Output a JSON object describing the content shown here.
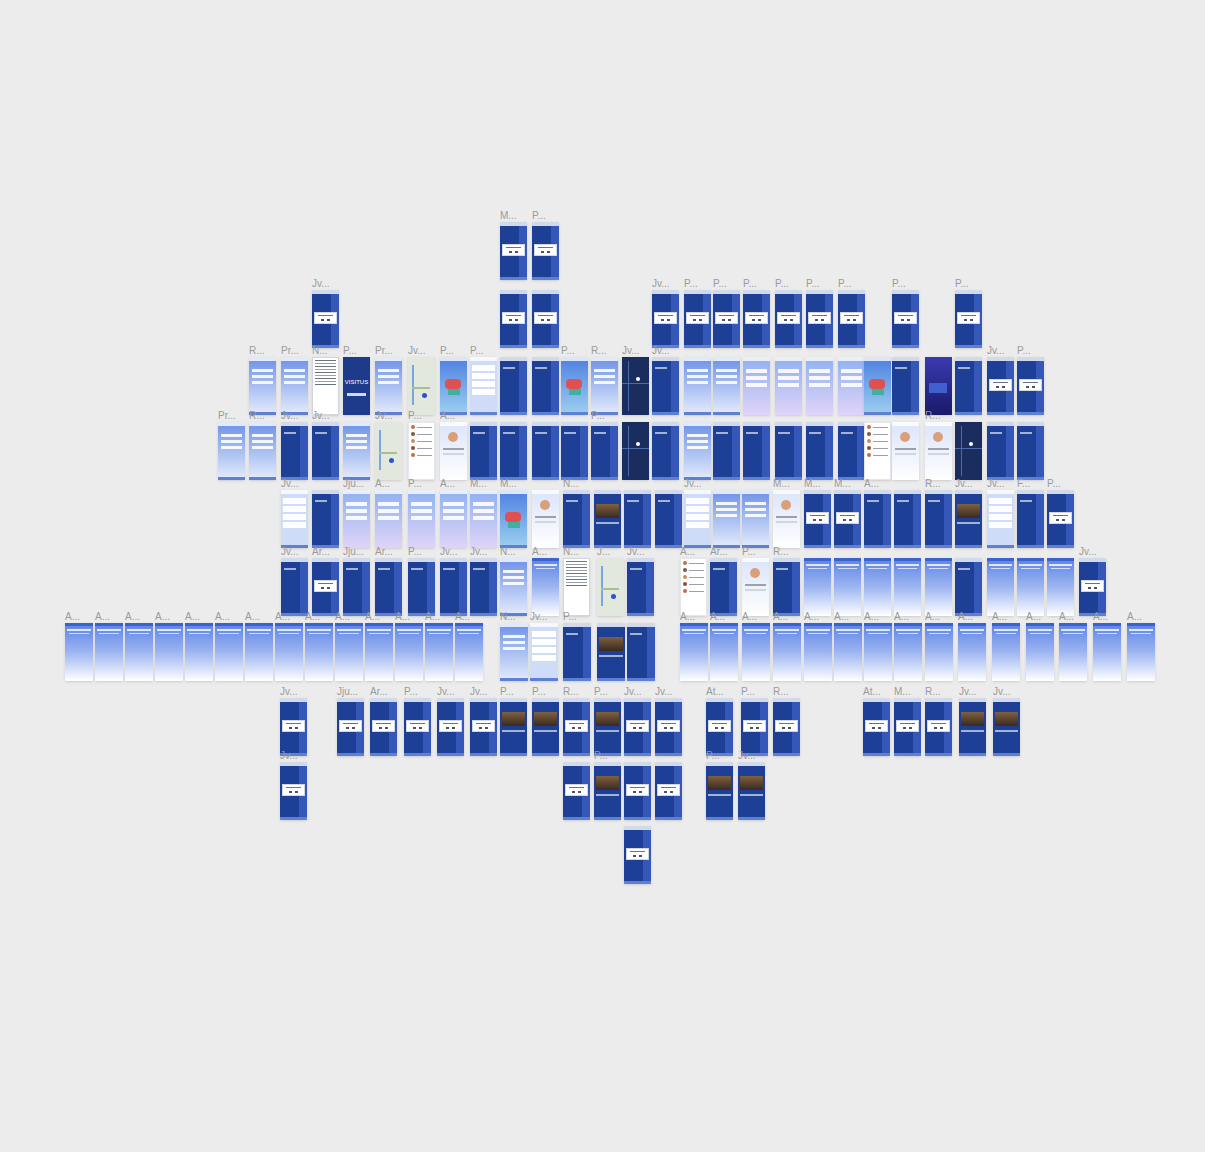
{
  "canvas": {
    "rows": [
      {
        "frames": [
          {
            "label": "M...",
            "kind": "dialog"
          },
          {
            "label": "P...",
            "kind": "dialog"
          }
        ]
      },
      {
        "frames": [
          {
            "label": "Jv...",
            "kind": "dialog"
          },
          {
            "label": "",
            "kind": "dialog"
          },
          {
            "label": "",
            "kind": "dialog"
          },
          {
            "label": "Jv...",
            "kind": "dialog"
          },
          {
            "label": "P...",
            "kind": "dialog"
          },
          {
            "label": "P...",
            "kind": "dialog"
          },
          {
            "label": "P...",
            "kind": "dialog"
          },
          {
            "label": "P...",
            "kind": "dialog"
          },
          {
            "label": "P...",
            "kind": "dialog"
          },
          {
            "label": "P...",
            "kind": "dialog"
          },
          {
            "label": "P...",
            "kind": "dialog"
          },
          {
            "label": "P...",
            "kind": "dialog"
          }
        ]
      },
      {
        "frames": [
          {
            "label": "R...",
            "kind": "light"
          },
          {
            "label": "Pr...",
            "kind": "light"
          },
          {
            "label": "N...",
            "kind": "doc"
          },
          {
            "label": "P...",
            "kind": "splash",
            "logo": "VISITUS"
          },
          {
            "label": "Pr...",
            "kind": "light"
          },
          {
            "label": "Jv...",
            "kind": "map"
          },
          {
            "label": "P...",
            "kind": "iso"
          },
          {
            "label": "P...",
            "kind": "list"
          },
          {
            "label": "",
            "kind": "dark"
          },
          {
            "label": "",
            "kind": "dark"
          },
          {
            "label": "P...",
            "kind": "iso"
          },
          {
            "label": "R...",
            "kind": "light"
          },
          {
            "label": "Jv...",
            "kind": "darkmap"
          },
          {
            "label": "Jv...",
            "kind": "dark"
          },
          {
            "label": "",
            "kind": "light"
          },
          {
            "label": "",
            "kind": "light"
          },
          {
            "label": "",
            "kind": "purple"
          },
          {
            "label": "",
            "kind": "purple"
          },
          {
            "label": "",
            "kind": "purple"
          },
          {
            "label": "",
            "kind": "purple"
          },
          {
            "label": "",
            "kind": "iso"
          },
          {
            "label": "",
            "kind": "dark"
          },
          {
            "label": "",
            "kind": "navy"
          },
          {
            "label": "",
            "kind": "dark"
          },
          {
            "label": "Jv...",
            "kind": "dialog"
          },
          {
            "label": "P...",
            "kind": "dialog"
          }
        ]
      },
      {
        "frames": [
          {
            "label": "Pr...",
            "kind": "light"
          },
          {
            "label": "R...",
            "kind": "light"
          },
          {
            "label": "Jv...",
            "kind": "dark"
          },
          {
            "label": "Jv...",
            "kind": "dark"
          },
          {
            "label": "",
            "kind": "light"
          },
          {
            "label": "Jv...",
            "kind": "map"
          },
          {
            "label": "P...",
            "kind": "people"
          },
          {
            "label": "A...",
            "kind": "profile"
          },
          {
            "label": "",
            "kind": "dark"
          },
          {
            "label": "",
            "kind": "dark"
          },
          {
            "label": "",
            "kind": "dark"
          },
          {
            "label": "",
            "kind": "dark"
          },
          {
            "label": "P...",
            "kind": "dark"
          },
          {
            "label": "",
            "kind": "darkmap"
          },
          {
            "label": "",
            "kind": "dark"
          },
          {
            "label": "",
            "kind": "light"
          },
          {
            "label": "",
            "kind": "dark"
          },
          {
            "label": "",
            "kind": "dark"
          },
          {
            "label": "",
            "kind": "dark"
          },
          {
            "label": "",
            "kind": "dark"
          },
          {
            "label": "",
            "kind": "dark"
          },
          {
            "label": "",
            "kind": "people"
          },
          {
            "label": "",
            "kind": "profile"
          },
          {
            "label": "R...",
            "kind": "profile"
          },
          {
            "label": "",
            "kind": "darkmap"
          },
          {
            "label": "",
            "kind": "dark"
          },
          {
            "label": "",
            "kind": "dark"
          }
        ]
      },
      {
        "frames": [
          {
            "label": "Jv...",
            "kind": "list"
          },
          {
            "label": "",
            "kind": "dark"
          },
          {
            "label": "Jju...",
            "kind": "purple"
          },
          {
            "label": "A...",
            "kind": "purple"
          },
          {
            "label": "P...",
            "kind": "purple"
          },
          {
            "label": "A...",
            "kind": "purple"
          },
          {
            "label": "M...",
            "kind": "purple"
          },
          {
            "label": "M...",
            "kind": "iso"
          },
          {
            "label": "",
            "kind": "profile"
          },
          {
            "label": "N...",
            "kind": "dark"
          },
          {
            "label": "",
            "kind": "photo"
          },
          {
            "label": "",
            "kind": "dark"
          },
          {
            "label": "",
            "kind": "dark"
          },
          {
            "label": "Jv...",
            "kind": "list"
          },
          {
            "label": "",
            "kind": "light"
          },
          {
            "label": "",
            "kind": "light"
          },
          {
            "label": "M...",
            "kind": "profile"
          },
          {
            "label": "M...",
            "kind": "dialog"
          },
          {
            "label": "M...",
            "kind": "dialog"
          },
          {
            "label": "A...",
            "kind": "dark"
          },
          {
            "label": "",
            "kind": "dark"
          },
          {
            "label": "R...",
            "kind": "dark"
          },
          {
            "label": "Jv...",
            "kind": "photo"
          },
          {
            "label": "Jv...",
            "kind": "list"
          },
          {
            "label": "F...",
            "kind": "dark"
          },
          {
            "label": "P...",
            "kind": "dialog"
          }
        ]
      },
      {
        "frames": [
          {
            "label": "Jv...",
            "kind": "dark"
          },
          {
            "label": "Ar...",
            "kind": "dialog"
          },
          {
            "label": "Jju...",
            "kind": "dark"
          },
          {
            "label": "Ar...",
            "kind": "dark"
          },
          {
            "label": "P...",
            "kind": "dark"
          },
          {
            "label": "Jv...",
            "kind": "dark"
          },
          {
            "label": "Jv...",
            "kind": "dark"
          },
          {
            "label": "N...",
            "kind": "light"
          },
          {
            "label": "A...",
            "kind": "fade"
          },
          {
            "label": "N...",
            "kind": "doc"
          },
          {
            "label": "J...",
            "kind": "map"
          },
          {
            "label": "Jv...",
            "kind": "dark"
          },
          {
            "label": "A...",
            "kind": "people"
          },
          {
            "label": "Ar...",
            "kind": "dark"
          },
          {
            "label": "P...",
            "kind": "profile"
          },
          {
            "label": "R...",
            "kind": "dark"
          },
          {
            "label": "",
            "kind": "fade"
          },
          {
            "label": "",
            "kind": "fade"
          },
          {
            "label": "",
            "kind": "fade"
          },
          {
            "label": "",
            "kind": "fade"
          },
          {
            "label": "",
            "kind": "fade"
          },
          {
            "label": "",
            "kind": "dark"
          },
          {
            "label": "",
            "kind": "fade"
          },
          {
            "label": "",
            "kind": "fade"
          },
          {
            "label": "",
            "kind": "fade"
          },
          {
            "label": "Jv...",
            "kind": "dialog"
          }
        ]
      },
      {
        "frames": [
          {
            "label": "A...",
            "kind": "fade"
          },
          {
            "label": "A...",
            "kind": "fade"
          },
          {
            "label": "A...",
            "kind": "fade"
          },
          {
            "label": "A...",
            "kind": "fade"
          },
          {
            "label": "A...",
            "kind": "fade"
          },
          {
            "label": "A...",
            "kind": "fade"
          },
          {
            "label": "A...",
            "kind": "fade"
          },
          {
            "label": "A...",
            "kind": "fade"
          },
          {
            "label": "A...",
            "kind": "fade"
          },
          {
            "label": "A...",
            "kind": "fade"
          },
          {
            "label": "A...",
            "kind": "fade"
          },
          {
            "label": "A...",
            "kind": "fade"
          },
          {
            "label": "A...",
            "kind": "fade"
          },
          {
            "label": "A...",
            "kind": "fade"
          },
          {
            "label": "N...",
            "kind": "light"
          },
          {
            "label": "Jv...",
            "kind": "list"
          },
          {
            "label": "P...",
            "kind": "dark"
          },
          {
            "label": "",
            "kind": "photo"
          },
          {
            "label": "",
            "kind": "dark"
          },
          {
            "label": "A...",
            "kind": "fade"
          },
          {
            "label": "A...",
            "kind": "fade"
          },
          {
            "label": "A...",
            "kind": "fade"
          },
          {
            "label": "A...",
            "kind": "fade"
          },
          {
            "label": "A...",
            "kind": "fade"
          },
          {
            "label": "A...",
            "kind": "fade"
          },
          {
            "label": "A...",
            "kind": "fade"
          },
          {
            "label": "A...",
            "kind": "fade"
          },
          {
            "label": "A...",
            "kind": "fade"
          },
          {
            "label": "A...",
            "kind": "fade"
          },
          {
            "label": "A...",
            "kind": "fade"
          },
          {
            "label": "A...",
            "kind": "fade"
          },
          {
            "label": "A...",
            "kind": "fade"
          },
          {
            "label": "A...",
            "kind": "fade"
          },
          {
            "label": "A...",
            "kind": "fade"
          }
        ]
      },
      {
        "frames": [
          {
            "label": "Jv...",
            "kind": "dialog"
          },
          {
            "label": "Jju...",
            "kind": "dialog"
          },
          {
            "label": "Ar...",
            "kind": "dialog"
          },
          {
            "label": "P...",
            "kind": "dialog"
          },
          {
            "label": "Jv...",
            "kind": "dialog"
          },
          {
            "label": "Jv...",
            "kind": "dialog"
          },
          {
            "label": "P...",
            "kind": "photo"
          },
          {
            "label": "P...",
            "kind": "photo"
          },
          {
            "label": "R...",
            "kind": "dialog"
          },
          {
            "label": "P...",
            "kind": "photo"
          },
          {
            "label": "Jv...",
            "kind": "dialog"
          },
          {
            "label": "Jv...",
            "kind": "dialog"
          },
          {
            "label": "At...",
            "kind": "dialog"
          },
          {
            "label": "P...",
            "kind": "dialog"
          },
          {
            "label": "R...",
            "kind": "dialog"
          },
          {
            "label": "At...",
            "kind": "dialog"
          },
          {
            "label": "M...",
            "kind": "dialog"
          },
          {
            "label": "R...",
            "kind": "dialog"
          },
          {
            "label": "Jv...",
            "kind": "photo"
          },
          {
            "label": "Jv...",
            "kind": "photo"
          }
        ]
      },
      {
        "frames": [
          {
            "label": "Jv...",
            "kind": "dialog"
          },
          {
            "label": "",
            "kind": "dialog"
          },
          {
            "label": "P...",
            "kind": "photo"
          },
          {
            "label": "",
            "kind": "dialog"
          },
          {
            "label": "",
            "kind": "dialog"
          },
          {
            "label": "P...",
            "kind": "photo"
          },
          {
            "label": "Jv...",
            "kind": "photo"
          }
        ]
      },
      {
        "frames": [
          {
            "label": "",
            "kind": "dialog"
          }
        ]
      }
    ]
  }
}
